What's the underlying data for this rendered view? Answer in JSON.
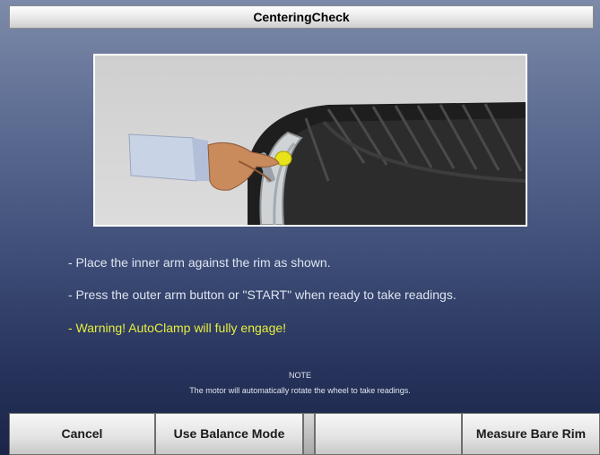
{
  "window": {
    "title": "CenteringCheck"
  },
  "illustration": {
    "icon": "wheel-clamp-arm-illustration"
  },
  "instructions": [
    "- Place the inner arm against the rim as shown.",
    "- Press the outer arm button or \"START\" when ready to take readings.",
    "- Warning! AutoClamp will fully engage!"
  ],
  "note": {
    "title": "NOTE",
    "text": "The motor will automatically rotate the wheel to take readings."
  },
  "softkeys": {
    "cancel": "Cancel",
    "use_balance_mode": "Use Balance Mode",
    "empty": "",
    "measure_bare_rim": "Measure Bare Rim"
  },
  "colors": {
    "warning": "#e6ee3e",
    "background_top": "#7d8aa9",
    "background_bottom": "#1b2548"
  }
}
